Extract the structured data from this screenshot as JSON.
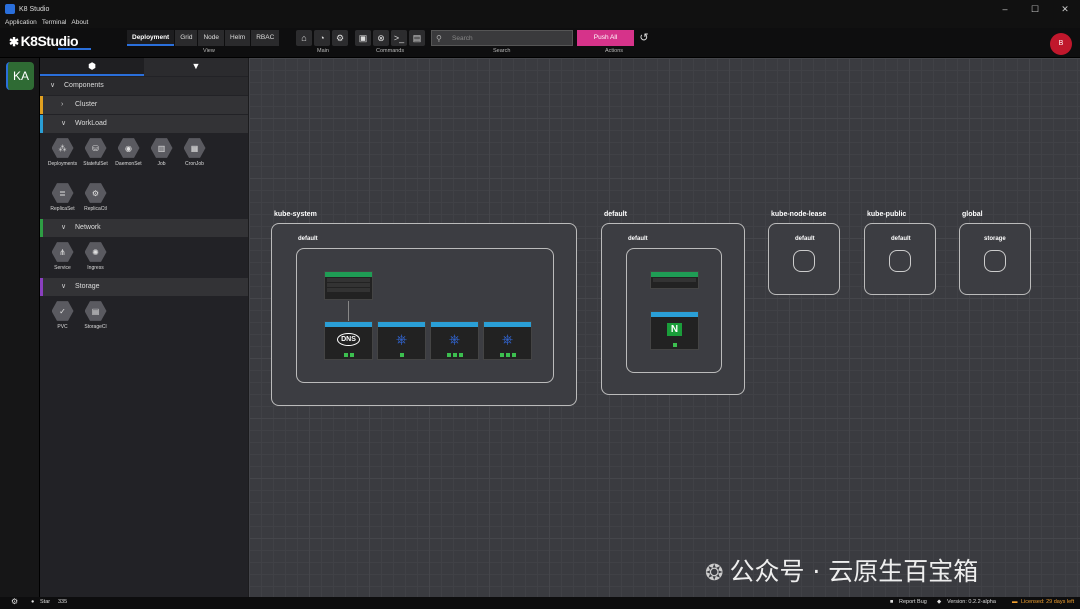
{
  "window": {
    "title": "K8 Studio",
    "controls": [
      "–",
      "☐",
      "✕"
    ]
  },
  "menu": [
    "Application",
    "Terminal",
    "About"
  ],
  "toolbar": {
    "logo": "K8Studio",
    "view_tabs": [
      "Deployment",
      "Grid",
      "Node",
      "Helm",
      "RBAC"
    ],
    "groups": {
      "view": "View",
      "main": "Main",
      "commands": "Commands",
      "search": "Search",
      "actions": "Actions"
    },
    "search_placeholder": "Search",
    "push_all": "Push All",
    "avatar": "B"
  },
  "rail": {
    "cluster_badge": "KA"
  },
  "sidebar": {
    "sections": {
      "components": "Components",
      "cluster": "Cluster",
      "workload": "WorkLoad",
      "network": "Network",
      "storage": "Storage"
    },
    "workload_items": [
      "Deployments",
      "StatefulSet",
      "DaemonSet",
      "Job",
      "CronJob",
      "ReplicaSet",
      "ReplicaCtl"
    ],
    "network_items": [
      "Service",
      "Ingress"
    ],
    "storage_items": [
      "PVC",
      "StorageCl"
    ],
    "section_colors": {
      "cluster": "#e0a020",
      "workload": "#2a9fd6",
      "network": "#2e9e44",
      "storage": "#8a3fbf"
    }
  },
  "canvas": {
    "namespaces": [
      {
        "name": "kube-system",
        "inner": "default"
      },
      {
        "name": "default",
        "inner": "default"
      },
      {
        "name": "kube-node-lease",
        "inner": "default"
      },
      {
        "name": "kube-public",
        "inner": "default"
      },
      {
        "name": "global",
        "inner": "storage"
      }
    ],
    "dns_label": "DNS",
    "nginx_label": "N"
  },
  "status": {
    "star": "Star",
    "star_count": "335",
    "report_bug": "Report Bug",
    "version": "Version: 0.2.2-alpha",
    "license": "Licensed: 29 days left"
  },
  "watermark": "公众号 · 云原生百宝箱"
}
